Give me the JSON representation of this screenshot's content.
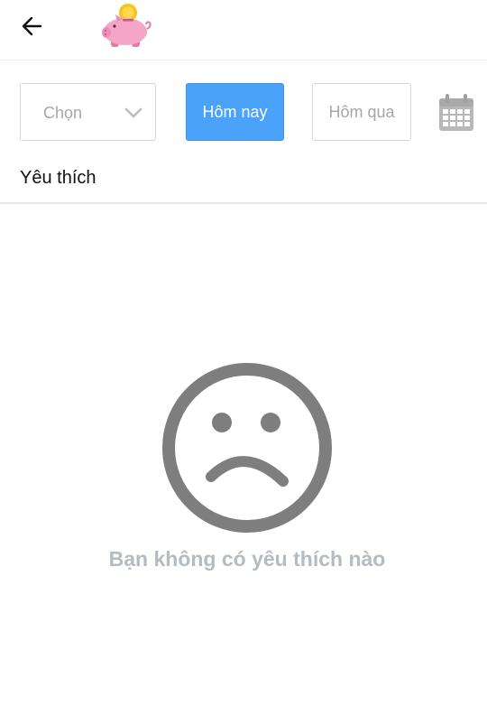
{
  "header": {
    "back_icon": "arrow-left-icon",
    "logo_icon": "piggy-bank-icon"
  },
  "filters": {
    "select_label": "Chọn",
    "select_icon": "chevron-down-icon",
    "today_label": "Hôm nay",
    "yesterday_label": "Hôm qua",
    "calendar_icon": "calendar-icon"
  },
  "section": {
    "title": "Yêu thích"
  },
  "empty_state": {
    "icon": "sad-face-icon",
    "message": "Bạn không có yêu thích nào"
  },
  "colors": {
    "accent": "#4aa3f8",
    "pig_pink": "#f4a6c6",
    "coin_gold": "#f7c21b",
    "empty_gray": "#7e7e7e",
    "message_gray": "#b4bcc2"
  }
}
